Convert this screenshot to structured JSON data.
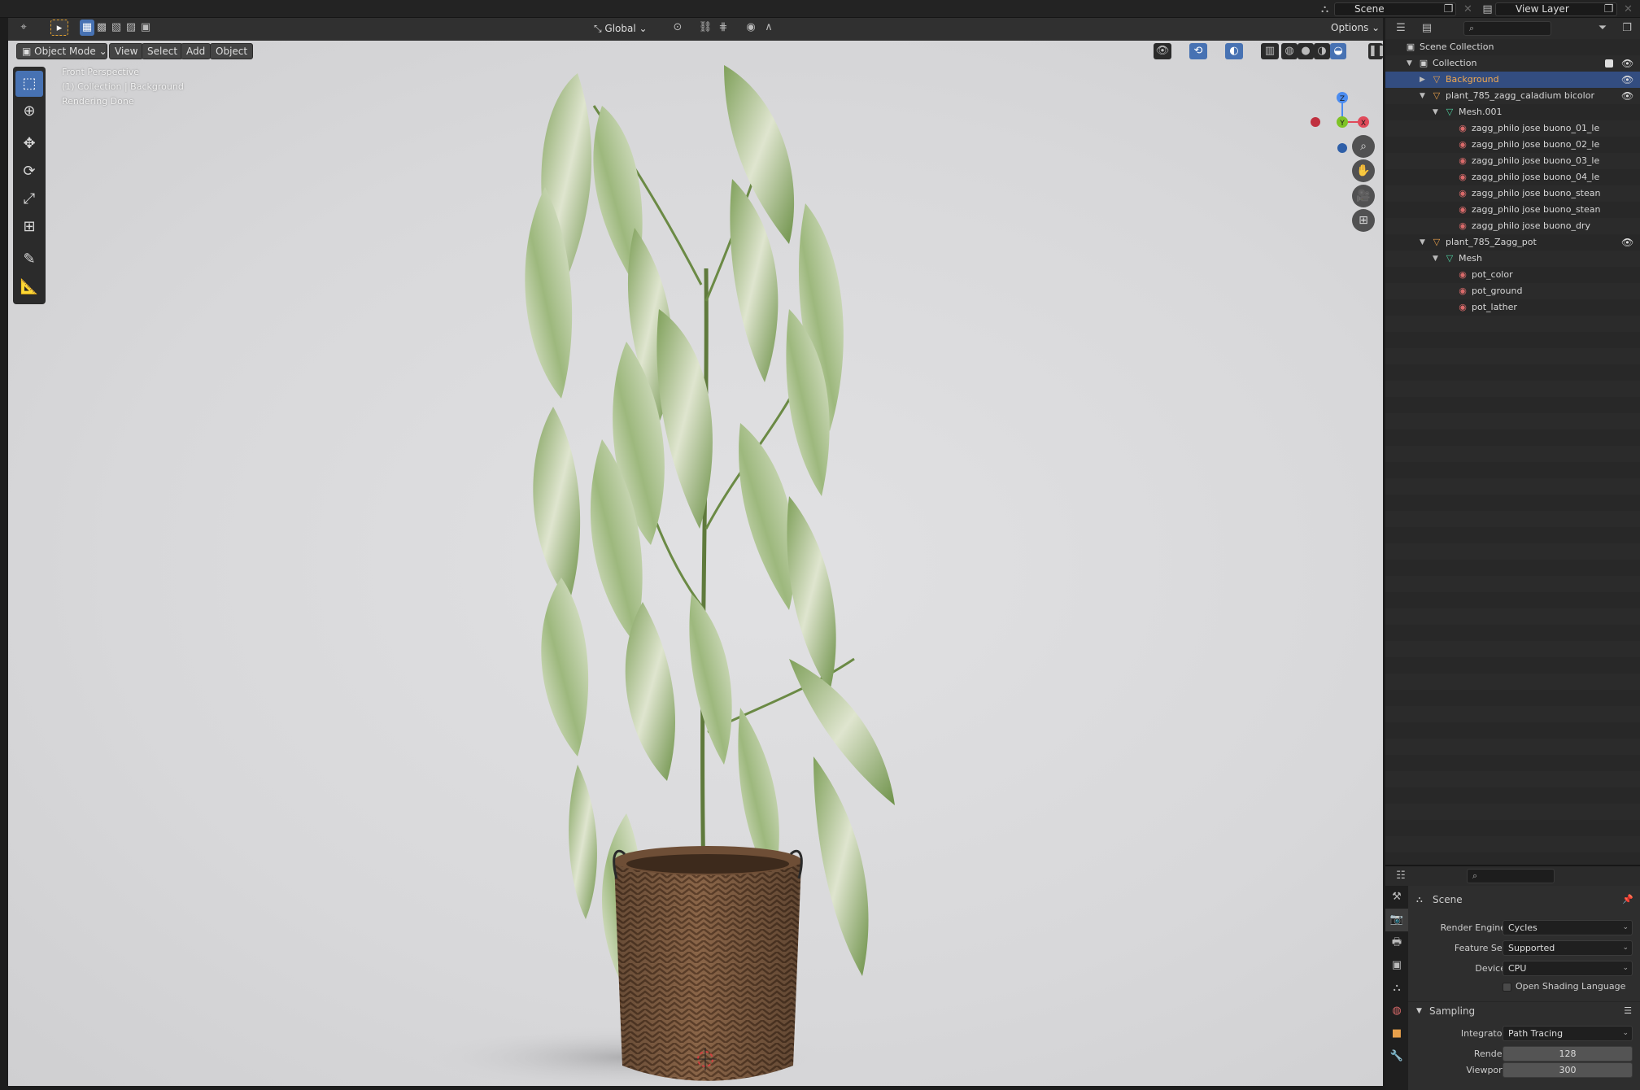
{
  "topbar": {
    "scene": "Scene",
    "view_layer": "View Layer"
  },
  "viewport_header": {
    "mode": "Object Mode",
    "menus": [
      "View",
      "Select",
      "Add",
      "Object"
    ],
    "orientation": "Global",
    "options": "Options"
  },
  "viewport": {
    "overlay_lines": [
      "Front Perspective",
      "(1) Collection | Background",
      "Rendering Done"
    ],
    "gizmo_axes": {
      "z": "Z",
      "y": "Y",
      "x": "X"
    }
  },
  "outliner": {
    "rows": [
      {
        "label": "Scene Collection",
        "indent": 0,
        "icon": "collection",
        "twisty": ""
      },
      {
        "label": "Collection",
        "indent": 1,
        "icon": "collection",
        "twisty": "▼"
      },
      {
        "label": "Background",
        "indent": 2,
        "icon": "object",
        "twisty": "▶",
        "selected": true
      },
      {
        "label": "plant_785_zagg_caladium bicolor",
        "indent": 2,
        "icon": "object",
        "twisty": "▼"
      },
      {
        "label": "Mesh.001",
        "indent": 3,
        "icon": "mesh",
        "twisty": "▼"
      },
      {
        "label": "zagg_philo jose buono_01_le",
        "indent": 4,
        "icon": "material",
        "twisty": ""
      },
      {
        "label": "zagg_philo jose buono_02_le",
        "indent": 4,
        "icon": "material",
        "twisty": ""
      },
      {
        "label": "zagg_philo jose buono_03_le",
        "indent": 4,
        "icon": "material",
        "twisty": ""
      },
      {
        "label": "zagg_philo jose buono_04_le",
        "indent": 4,
        "icon": "material",
        "twisty": ""
      },
      {
        "label": "zagg_philo jose buono_stean",
        "indent": 4,
        "icon": "material",
        "twisty": ""
      },
      {
        "label": "zagg_philo jose buono_stean",
        "indent": 4,
        "icon": "material",
        "twisty": ""
      },
      {
        "label": "zagg_philo jose buono_dry",
        "indent": 4,
        "icon": "material",
        "twisty": ""
      },
      {
        "label": "plant_785_Zagg_pot",
        "indent": 2,
        "icon": "object",
        "twisty": "▼"
      },
      {
        "label": "Mesh",
        "indent": 3,
        "icon": "mesh",
        "twisty": "▼"
      },
      {
        "label": "pot_color",
        "indent": 4,
        "icon": "material",
        "twisty": ""
      },
      {
        "label": "pot_ground",
        "indent": 4,
        "icon": "material",
        "twisty": ""
      },
      {
        "label": "pot_lather",
        "indent": 4,
        "icon": "material",
        "twisty": ""
      }
    ]
  },
  "properties": {
    "context": "Scene",
    "render_engine": {
      "label": "Render Engine",
      "value": "Cycles"
    },
    "feature_set": {
      "label": "Feature Set",
      "value": "Supported"
    },
    "device": {
      "label": "Device",
      "value": "CPU"
    },
    "osl": {
      "label": "Open Shading Language",
      "checked": false
    },
    "sampling": {
      "title": "Sampling",
      "integrator": {
        "label": "Integrator",
        "value": "Path Tracing"
      },
      "render": {
        "label": "Render",
        "value": "128"
      },
      "viewport": {
        "label": "Viewport",
        "value": "300"
      }
    }
  },
  "colors": {
    "accent": "#4772b3",
    "selected_row": "#334d80",
    "object_icon": "#e8a04b",
    "mesh_icon": "#4ed1a0",
    "material_icon": "#d96a6a"
  }
}
